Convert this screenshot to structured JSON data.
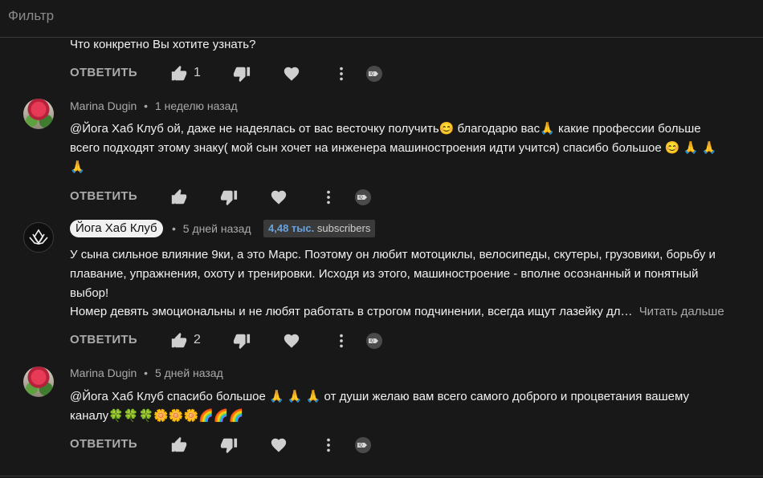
{
  "filter": {
    "placeholder": "Фильтр"
  },
  "comments": [
    {
      "text": "Что конкретно Вы хотите узнать?",
      "actions": {
        "reply": "ОТВЕТИТЬ",
        "likes": "1"
      }
    },
    {
      "author": "Marina Dugin",
      "time": "1 неделю назад",
      "text_lines": [
        " @Йога Хаб Клуб  ой, даже не надеялась от вас весточку получить😊 благодарю вас🙏 какие профессии больше",
        "всего подходят этому знаку( мой сын хочет на инженера машиностроения идти учится) спасибо большое 😊 🙏 🙏",
        "🙏"
      ],
      "actions": {
        "reply": "ОТВЕТИТЬ",
        "likes": ""
      }
    },
    {
      "author": "Йога Хаб Клуб",
      "time": "5 дней назад",
      "subscribers_count": "4,48 тыс.",
      "subscribers_label": "subscribers",
      "text_lines": [
        "У сына сильное влияние 9ки, а это Марс. Поэтому он любит мотоциклы, велосипеды, скутеры, грузовики, борьбу и",
        "плавание, упражнения, охоту и тренировки. Исходя из этого, машиностроение - вполне осознанный и понятный",
        "выбор!",
        "Номер девять эмоциональны и не любят работать в строгом подчинении, всегда ищут лазейку дл…"
      ],
      "read_more": "Читать дальше",
      "actions": {
        "reply": "ОТВЕТИТЬ",
        "likes": "2"
      }
    },
    {
      "author": "Marina Dugin",
      "time": "5 дней назад",
      "text_lines": [
        " @Йога Хаб Клуб  спасибо большое 🙏 🙏 🙏 от души желаю вам всего самого доброго и процветания вашему",
        "каналу🍀🍀🍀🌼🌼🌼🌈🌈🌈"
      ],
      "actions": {
        "reply": "ОТВЕТИТЬ",
        "likes": ""
      }
    }
  ],
  "separator": "•",
  "icons": {
    "like": "thumbs-up-icon",
    "dislike": "thumbs-down-icon",
    "heart": "heart-icon",
    "more": "more-vertical-icon",
    "badge": "comment-badge-icon"
  },
  "colors": {
    "background": "#181818",
    "text": "#f1f1f1",
    "secondary": "#aaaaaa",
    "subscriber_count": "#66a3e0"
  }
}
